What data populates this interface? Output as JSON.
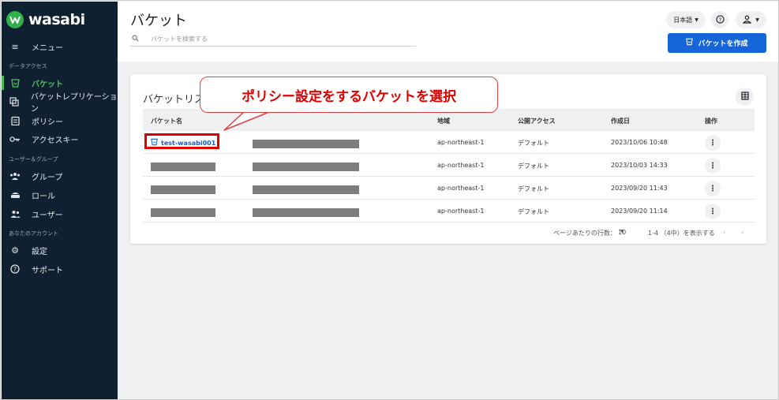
{
  "brand": {
    "name": "wasabi"
  },
  "sidebar": {
    "menu_label": "メニュー",
    "sections": {
      "data_access": "データアクセス",
      "users_groups": "ユーザー＆グループ",
      "your_account": "あなたのアカウント"
    },
    "items": [
      {
        "label": "バケット",
        "icon": "bucket-icon"
      },
      {
        "label": "バケットレプリケーション",
        "icon": "replication-icon"
      },
      {
        "label": "ポリシー",
        "icon": "policy-icon"
      },
      {
        "label": "アクセスキー",
        "icon": "key-icon"
      },
      {
        "label": "グループ",
        "icon": "group-icon"
      },
      {
        "label": "ロール",
        "icon": "role-icon"
      },
      {
        "label": "ユーザー",
        "icon": "users-icon"
      },
      {
        "label": "設定",
        "icon": "gear-icon"
      },
      {
        "label": "サポート",
        "icon": "help-icon"
      }
    ],
    "active_item": "バケット"
  },
  "header": {
    "title": "バケット",
    "search_placeholder": "バケットを検索する",
    "language": "日本語",
    "create_button": "バケットを作成"
  },
  "card": {
    "title": "バケットリスト",
    "columns": [
      "バケット名",
      "地域",
      "公開アクセス",
      "作成日",
      "操作"
    ],
    "rows": [
      {
        "name": "test-wasabi001",
        "region": "ap-northeast-1",
        "access": "デフォルト",
        "created": "2023/10/06 10:48"
      },
      {
        "name": "",
        "region": "ap-northeast-1",
        "access": "デフォルト",
        "created": "2023/10/03 14:33"
      },
      {
        "name": "",
        "region": "ap-northeast-1",
        "access": "デフォルト",
        "created": "2023/09/20 11:43"
      },
      {
        "name": "",
        "region": "ap-northeast-1",
        "access": "デフォルト",
        "created": "2023/09/20 11:14"
      }
    ],
    "pager": {
      "rows_per_page_label": "ページあたりの行数：",
      "rows_per_page": "10",
      "range": "1-4 （4中）を表示する"
    }
  },
  "callout": {
    "text": "ポリシー設定をするバケットを選択"
  },
  "colors": {
    "sidebar_bg": "#0f2131",
    "brand_green": "#3fbf57",
    "primary": "#1565d8",
    "annotation_red": "#e00000"
  }
}
